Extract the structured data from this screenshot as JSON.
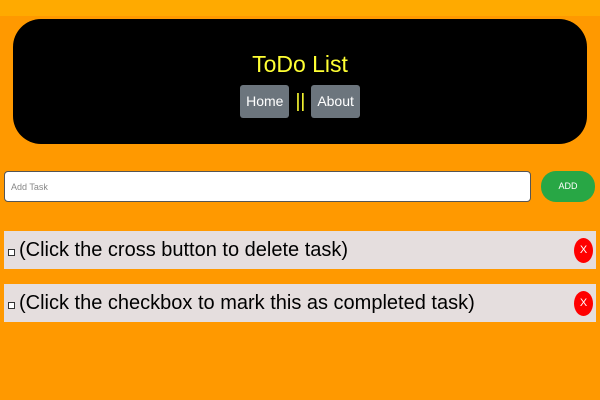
{
  "header": {
    "title": "ToDo List",
    "nav": [
      {
        "label": "Home"
      },
      {
        "label": "About"
      }
    ],
    "separator": "||"
  },
  "add_task": {
    "placeholder": "Add Task",
    "value": "",
    "button_label": "ADD"
  },
  "tasks": [
    {
      "text": "(Click the cross button to delete task)",
      "completed": false,
      "delete_label": "X"
    },
    {
      "text": "(Click the checkbox to mark this as completed task)",
      "completed": false,
      "delete_label": "X"
    }
  ],
  "colors": {
    "page_background": "#ff9900",
    "header_background": "#000000",
    "title": "#ffff33",
    "nav_button": "#6c757d",
    "add_button": "#28a745",
    "task_background": "#e5dede",
    "delete_button": "#ff0000"
  }
}
